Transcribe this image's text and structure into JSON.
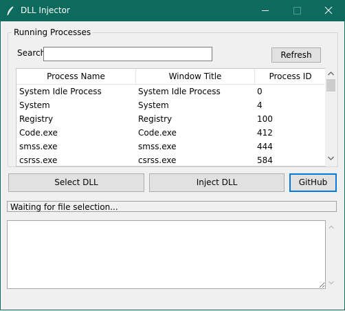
{
  "window": {
    "title": "DLL Injector"
  },
  "group": {
    "label": "Running Processes"
  },
  "search": {
    "label": "Search",
    "value": ""
  },
  "refresh_label": "Refresh",
  "table": {
    "columns": [
      "Process Name",
      "Window Title",
      "Process ID"
    ],
    "rows": [
      [
        "System Idle Process",
        "System Idle Process",
        "0"
      ],
      [
        "System",
        "System",
        "4"
      ],
      [
        "Registry",
        "Registry",
        "100"
      ],
      [
        "Code.exe",
        "Code.exe",
        "412"
      ],
      [
        "smss.exe",
        "smss.exe",
        "444"
      ],
      [
        "csrss.exe",
        "csrss.exe",
        "584"
      ]
    ]
  },
  "buttons": {
    "select_dll": "Select DLL",
    "inject_dll": "Inject DLL",
    "github": "GitHub"
  },
  "status": "Waiting for file selection...",
  "log": {
    "value": ""
  },
  "colors": {
    "titlebar": "#0d6b5e",
    "focus_border": "#0078d7"
  },
  "icons": {
    "app": "feather-icon",
    "minimize": "minimize-icon",
    "maximize": "maximize-icon",
    "close": "close-icon"
  }
}
